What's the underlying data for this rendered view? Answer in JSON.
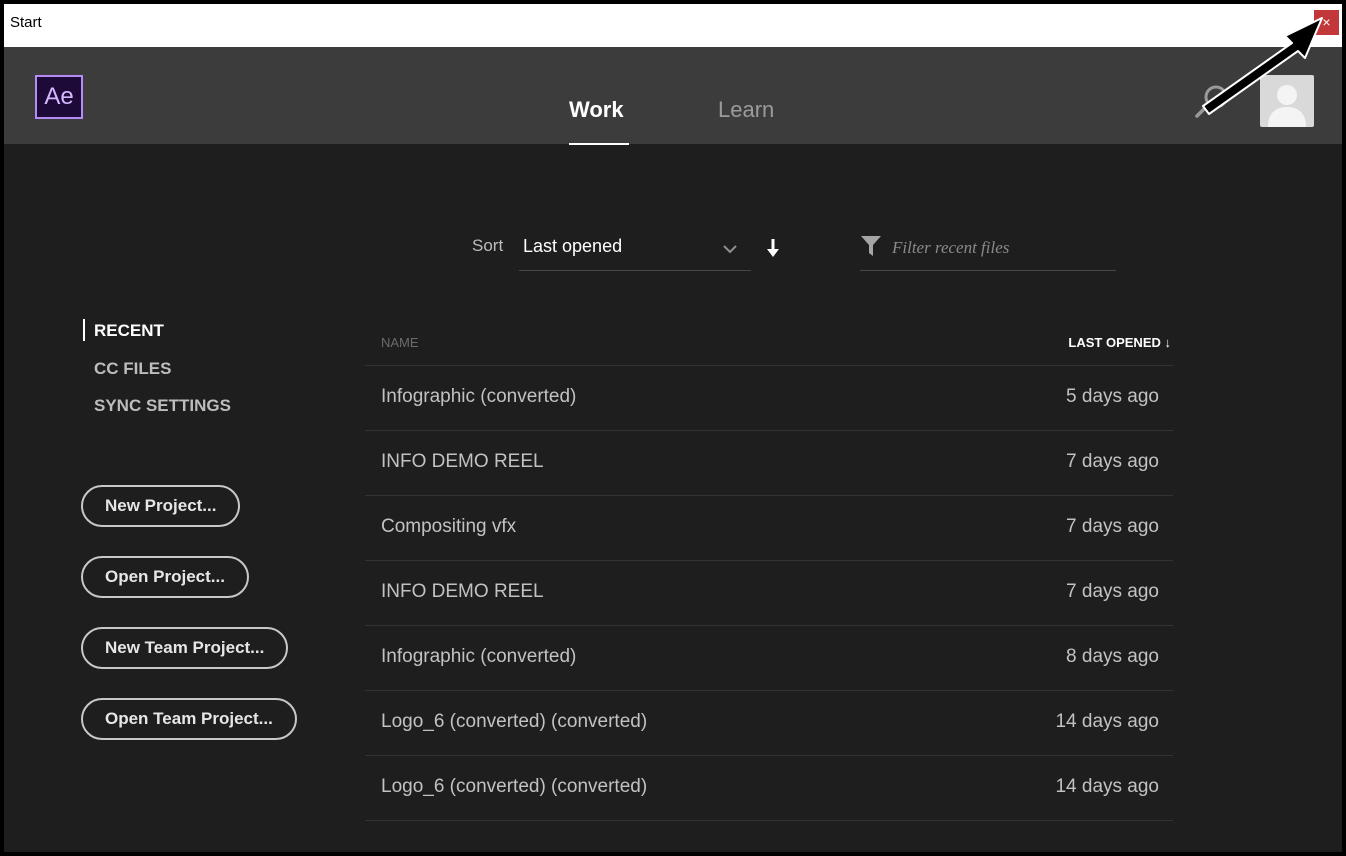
{
  "window": {
    "title": "Start",
    "close_glyph": "×"
  },
  "app": {
    "logo_text": "Ae",
    "logo_color": "#b58cf5"
  },
  "tabs": [
    {
      "label": "Work",
      "active": true
    },
    {
      "label": "Learn",
      "active": false
    }
  ],
  "header_icons": {
    "search": "search-icon",
    "avatar": "user-avatar-icon"
  },
  "sort": {
    "label": "Sort",
    "value": "Last opened",
    "direction": "descending"
  },
  "filter": {
    "placeholder": "Filter recent files"
  },
  "nav": {
    "recent": "RECENT",
    "cc_files": "CC FILES",
    "sync_settings": "SYNC SETTINGS"
  },
  "buttons": {
    "new_project": "New Project...",
    "open_project": "Open Project...",
    "new_team_project": "New Team Project...",
    "open_team_project": "Open Team Project..."
  },
  "files": {
    "col_name": "NAME",
    "col_last_opened": "LAST OPENED ↓",
    "rows": [
      {
        "name": "Infographic (converted)",
        "opened": "5 days ago"
      },
      {
        "name": "INFO DEMO REEL",
        "opened": "7 days ago"
      },
      {
        "name": "Compositing vfx",
        "opened": "7 days ago"
      },
      {
        "name": "INFO DEMO REEL",
        "opened": "7 days ago"
      },
      {
        "name": "Infographic (converted)",
        "opened": "8 days ago"
      },
      {
        "name": "Logo_6 (converted) (converted)",
        "opened": "14 days ago"
      },
      {
        "name": "Logo_6 (converted) (converted)",
        "opened": "14 days ago"
      }
    ]
  },
  "colors": {
    "background": "#1e1e1e",
    "header": "#3c3c3c",
    "close_button": "#c1373a"
  }
}
